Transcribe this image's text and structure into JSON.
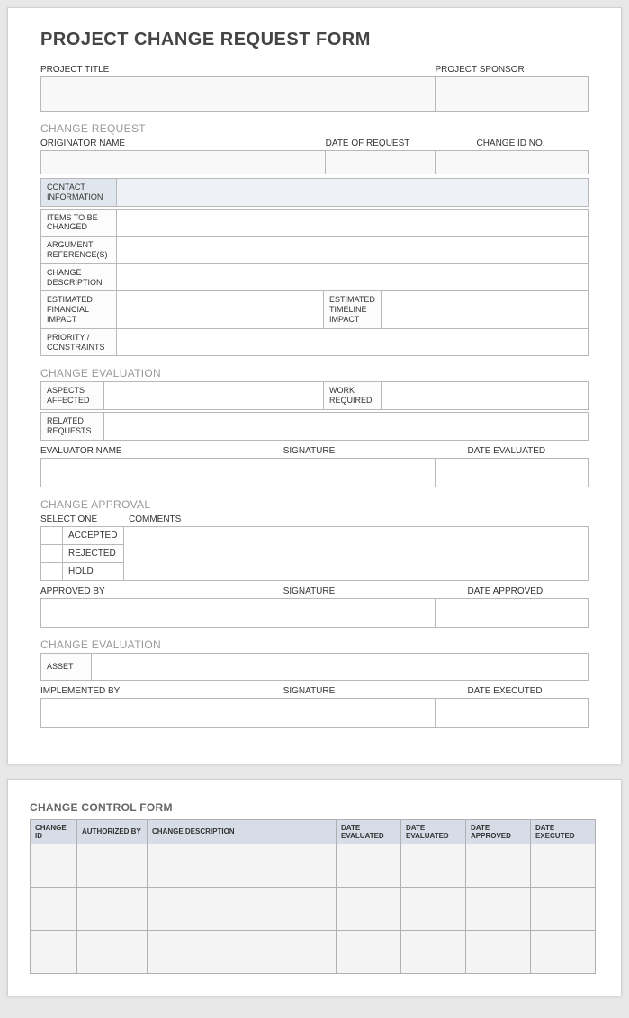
{
  "form_title": "PROJECT CHANGE REQUEST FORM",
  "top": {
    "project_title_label": "PROJECT TITLE",
    "project_sponsor_label": "PROJECT SPONSOR"
  },
  "change_request": {
    "heading": "CHANGE REQUEST",
    "originator_label": "ORIGINATOR NAME",
    "date_label": "DATE OF REQUEST",
    "change_id_label": "CHANGE ID NO.",
    "rows": {
      "contact_info": "CONTACT INFORMATION",
      "items_changed": "ITEMS TO BE CHANGED",
      "argument_ref": "ARGUMENT REFERENCE(S)",
      "change_desc": "CHANGE DESCRIPTION",
      "est_financial": "ESTIMATED FINANCIAL IMPACT",
      "est_timeline": "ESTIMATED TIMELINE IMPACT",
      "priority": "PRIORITY / CONSTRAINTS"
    }
  },
  "change_evaluation": {
    "heading": "CHANGE EVALUATION",
    "aspects": "ASPECTS AFFECTED",
    "work_required": "WORK REQUIRED",
    "related": "RELATED REQUESTS",
    "evaluator_label": "EVALUATOR NAME",
    "signature_label": "SIGNATURE",
    "date_eval_label": "DATE EVALUATED"
  },
  "change_approval": {
    "heading": "CHANGE APPROVAL",
    "select_one": "SELECT ONE",
    "comments": "COMMENTS",
    "accepted": "ACCEPTED",
    "rejected": "REJECTED",
    "hold": "HOLD",
    "approved_by": "APPROVED BY",
    "signature": "SIGNATURE",
    "date_approved": "DATE APPROVED"
  },
  "change_evaluation2": {
    "heading": "CHANGE EVALUATION",
    "asset": "ASSET",
    "implemented_by": "IMPLEMENTED BY",
    "signature": "SIGNATURE",
    "date_executed": "DATE EXECUTED"
  },
  "control_form": {
    "title": "CHANGE CONTROL FORM",
    "headers": {
      "change_id": "CHANGE ID",
      "authorized_by": "AUTHORIZED BY",
      "change_desc": "CHANGE DESCRIPTION",
      "date_eval1": "DATE EVALUATED",
      "date_eval2": "DATE EVALUATED",
      "date_approved": "DATE APPROVED",
      "date_executed": "DATE EXECUTED"
    }
  }
}
